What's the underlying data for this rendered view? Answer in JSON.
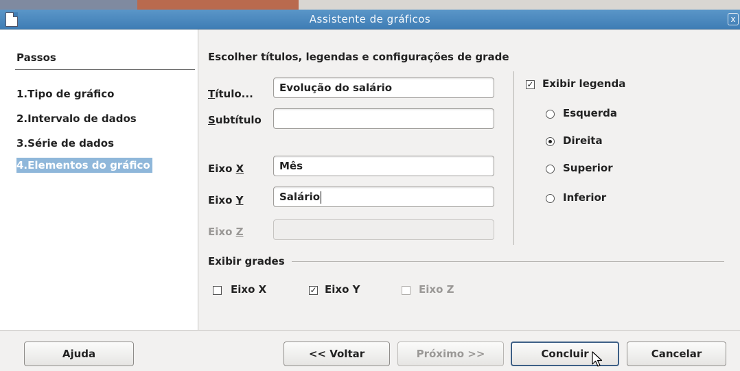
{
  "window": {
    "title": "Assistente de gráficos",
    "close_label": "x"
  },
  "steps": {
    "header": "Passos",
    "items": [
      {
        "num": "1.",
        "label": "Tipo de gráfico"
      },
      {
        "num": "2.",
        "label": "Intervalo de dados"
      },
      {
        "num": "3.",
        "label": "Série de dados"
      },
      {
        "num": "4.",
        "label": "Elementos do gráfico"
      }
    ]
  },
  "main": {
    "heading": "Escolher títulos, legendas e configurações de grade",
    "title_label": "Título...",
    "title_value": "Evolução do salário",
    "subtitle_label": "Subtítulo",
    "subtitle_value": "",
    "xaxis_label": "Eixo X",
    "xaxis_value": "Mês",
    "yaxis_label": "Eixo Y",
    "yaxis_value": "Salário",
    "zaxis_label": "Eixo Z",
    "zaxis_value": ""
  },
  "legend": {
    "show_label": "Exibir legenda",
    "show_checked": true,
    "positions": [
      {
        "label": "Esquerda",
        "selected": false
      },
      {
        "label": "Direita",
        "selected": true
      },
      {
        "label": "Superior",
        "selected": false
      },
      {
        "label": "Inferior",
        "selected": false
      }
    ]
  },
  "grids": {
    "header": "Exibir grades",
    "x_label": "Eixo X",
    "x_checked": false,
    "y_label": "Eixo Y",
    "y_checked": true,
    "z_label": "Eixo Z",
    "z_checked": false
  },
  "buttons": {
    "help": "Ajuda",
    "back": "<< Voltar",
    "next": "Próximo >>",
    "finish": "Concluir",
    "cancel": "Cancelar"
  }
}
